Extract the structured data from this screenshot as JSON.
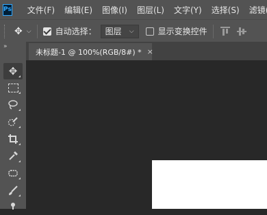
{
  "app": {
    "logo": "Ps"
  },
  "menu": [
    "文件(F)",
    "编辑(E)",
    "图像(I)",
    "图层(L)",
    "文字(Y)",
    "选择(S)",
    "滤镜(T)"
  ],
  "options": {
    "auto_select_label": "自动选择：",
    "auto_select_checked": true,
    "auto_select_target": "图层",
    "show_transform_label": "显示变换控件",
    "show_transform_checked": false
  },
  "document": {
    "tab_title": "未标题-1 @ 100%(RGB/8#) *",
    "close_glyph": "×"
  },
  "tools": [
    "move-icon",
    "marquee-icon",
    "lasso-icon",
    "quick-select-icon",
    "crop-icon",
    "eyedropper-icon",
    "healing-brush-icon",
    "brush-icon",
    "clone-stamp-icon"
  ],
  "colors": {
    "panel": "#535353",
    "canvas_bg": "#282828",
    "document": "#ffffff",
    "ps_blue": "#31a8ff"
  }
}
